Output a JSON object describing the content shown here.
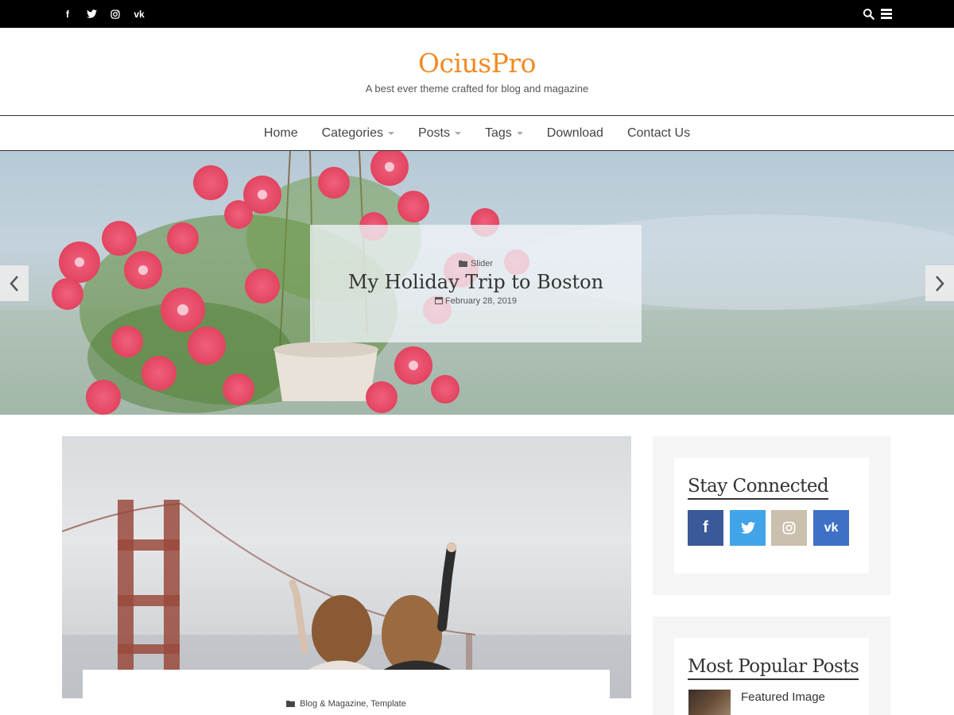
{
  "topbar": {
    "social": [
      {
        "name": "facebook",
        "icon": "facebook-icon",
        "glyph": "f"
      },
      {
        "name": "twitter",
        "icon": "twitter-icon"
      },
      {
        "name": "instagram",
        "icon": "instagram-icon"
      },
      {
        "name": "vk",
        "icon": "vk-icon",
        "glyph": "vk"
      }
    ],
    "right_icons": [
      "search-icon",
      "menu-icon"
    ]
  },
  "header": {
    "title": "OciusPro",
    "tagline": "A best ever theme crafted for blog and magazine",
    "title_color": "#f28a23"
  },
  "nav": {
    "items": [
      {
        "label": "Home",
        "dropdown": false
      },
      {
        "label": "Categories",
        "dropdown": true
      },
      {
        "label": "Posts",
        "dropdown": true
      },
      {
        "label": "Tags",
        "dropdown": true
      },
      {
        "label": "Download",
        "dropdown": false
      },
      {
        "label": "Contact Us",
        "dropdown": false
      }
    ]
  },
  "slider": {
    "category": "Slider",
    "title": "My Holiday Trip to Boston",
    "date": "February 28, 2019",
    "prev_icon": "chevron-left-icon",
    "next_icon": "chevron-right-icon"
  },
  "post": {
    "categories": "Blog & Magazine, Template"
  },
  "sidebar": {
    "stay_connected": {
      "title": "Stay Connected",
      "buttons": [
        {
          "name": "facebook",
          "icon": "facebook-icon",
          "glyph": "f",
          "color": "#3b5998"
        },
        {
          "name": "twitter",
          "icon": "twitter-icon",
          "color": "#42a4e8"
        },
        {
          "name": "instagram",
          "icon": "instagram-icon",
          "color": "#cbbfae"
        },
        {
          "name": "vk",
          "icon": "vk-icon",
          "glyph": "vk",
          "color": "#3e71c6"
        }
      ]
    },
    "popular": {
      "title": "Most Popular Posts",
      "items": [
        {
          "title": "Featured Image"
        }
      ]
    }
  }
}
